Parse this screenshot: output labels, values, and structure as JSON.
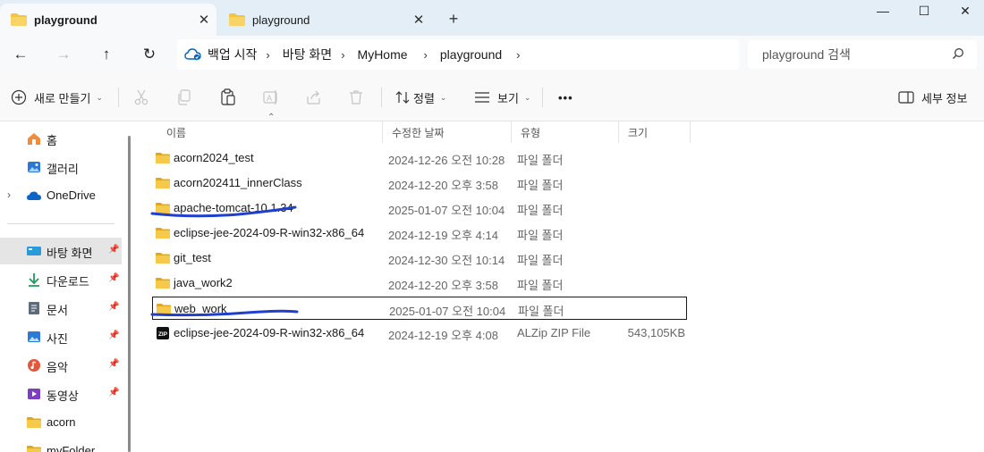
{
  "tabs": [
    {
      "label": "playground",
      "active": true
    },
    {
      "label": "playground",
      "active": false
    }
  ],
  "window": {
    "minimize": "—",
    "maximize": "☐",
    "close": "✕"
  },
  "address": {
    "crumbs": [
      "백업 시작",
      "바탕 화면",
      "MyHome",
      "playground"
    ],
    "search_placeholder": "playground 검색"
  },
  "commands": {
    "new": "새로 만들기",
    "sort": "정렬",
    "view": "보기",
    "more": "•••",
    "details": "세부 정보"
  },
  "sidebar": {
    "items": [
      {
        "label": "홈",
        "icon": "home-icon"
      },
      {
        "label": "갤러리",
        "icon": "gallery-icon"
      },
      {
        "label": "OneDrive",
        "icon": "cloud-icon"
      },
      {
        "label": "바탕 화면",
        "icon": "desktop-icon",
        "pinned": true,
        "selected": true
      },
      {
        "label": "다운로드",
        "icon": "download-icon",
        "pinned": true
      },
      {
        "label": "문서",
        "icon": "document-icon",
        "pinned": true
      },
      {
        "label": "사진",
        "icon": "picture-icon",
        "pinned": true
      },
      {
        "label": "음악",
        "icon": "music-icon",
        "pinned": true
      },
      {
        "label": "동영상",
        "icon": "video-icon",
        "pinned": true
      },
      {
        "label": "acorn",
        "icon": "folder-icon"
      },
      {
        "label": "myFolder",
        "icon": "folder-icon"
      }
    ]
  },
  "columns": {
    "name": "이름",
    "modified": "수정한 날짜",
    "type": "유형",
    "size": "크기"
  },
  "files": [
    {
      "name": "acorn2024_test",
      "modified": "2024-12-26 오전 10:28",
      "type": "파일 폴더",
      "size": "",
      "icon": "folder-icon"
    },
    {
      "name": "acorn202411_innerClass",
      "modified": "2024-12-20 오후 3:58",
      "type": "파일 폴더",
      "size": "",
      "icon": "folder-icon"
    },
    {
      "name": "apache-tomcat-10.1.34",
      "modified": "2025-01-07 오전 10:04",
      "type": "파일 폴더",
      "size": "",
      "icon": "folder-icon"
    },
    {
      "name": "eclipse-jee-2024-09-R-win32-x86_64",
      "modified": "2024-12-19 오후 4:14",
      "type": "파일 폴더",
      "size": "",
      "icon": "folder-icon"
    },
    {
      "name": "git_test",
      "modified": "2024-12-30 오전 10:14",
      "type": "파일 폴더",
      "size": "",
      "icon": "folder-icon"
    },
    {
      "name": "java_work2",
      "modified": "2024-12-20 오후 3:58",
      "type": "파일 폴더",
      "size": "",
      "icon": "folder-icon"
    },
    {
      "name": "web_work",
      "modified": "2025-01-07 오전 10:04",
      "type": "파일 폴더",
      "size": "",
      "icon": "folder-icon"
    },
    {
      "name": "eclipse-jee-2024-09-R-win32-x86_64",
      "modified": "2024-12-19 오후 4:08",
      "type": "ALZip ZIP File",
      "size": "543,105KB",
      "icon": "zip-icon"
    }
  ],
  "colors": {
    "folder": "#f4c542",
    "folder_dark": "#e0a81a",
    "accent": "#0067c0",
    "annotation": "#1f3fcf"
  }
}
